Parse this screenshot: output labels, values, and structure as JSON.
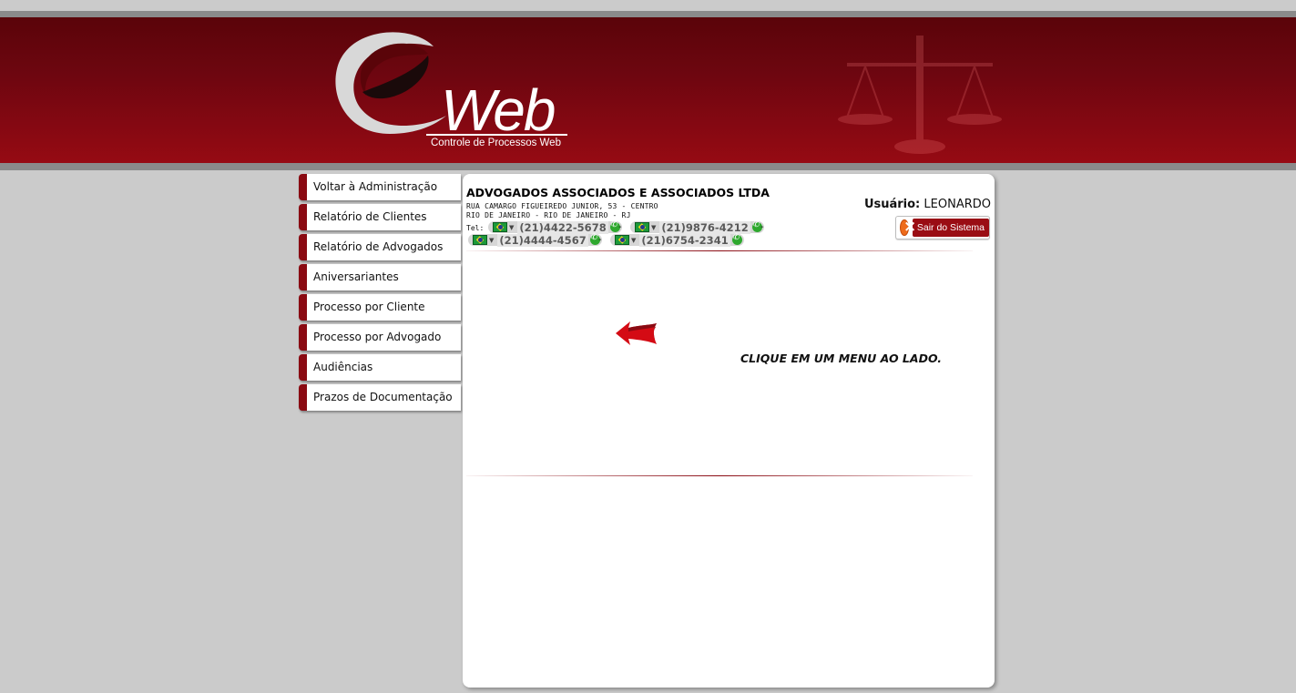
{
  "header": {
    "logo_wordmark": "Web",
    "logo_subtitle": "Controle de Processos Web"
  },
  "sidebar": {
    "items": [
      {
        "label": "Voltar à Administração"
      },
      {
        "label": "Relatório de Clientes"
      },
      {
        "label": "Relatório de Advogados"
      },
      {
        "label": "Aniversariantes"
      },
      {
        "label": "Processo por Cliente"
      },
      {
        "label": "Processo por Advogado"
      },
      {
        "label": "Audiências"
      },
      {
        "label": "Prazos de Documentação"
      }
    ]
  },
  "company": {
    "name": "ADVOGADOS ASSOCIADOS E ASSOCIADOS LTDA",
    "address_line1": "RUA CAMARGO FIGUEIREDO JUNIOR, 53 - CENTRO",
    "address_line2": "RIO DE JANEIRO - RIO DE JANEIRO - RJ",
    "tel_label": "Tel:",
    "phones": [
      "(21)4422-5678",
      "(21)9876-4212",
      "(21)4444-4567",
      "(21)6754-2341"
    ],
    "separator": "-"
  },
  "user": {
    "label": "Usuário:",
    "name": "LEONARDO",
    "logout_label": "Sair do Sistema"
  },
  "main": {
    "prompt": "CLIQUE EM UM MENU AO LADO."
  },
  "colors": {
    "brand": "#8a0a12",
    "header_dark": "#5a0409",
    "background": "#cbcbcb"
  },
  "icons": [
    "e-logo-icon",
    "scales-of-justice-icon",
    "brazil-flag-icon",
    "phone-call-icon",
    "logout-icon",
    "left-arrow-icon"
  ]
}
